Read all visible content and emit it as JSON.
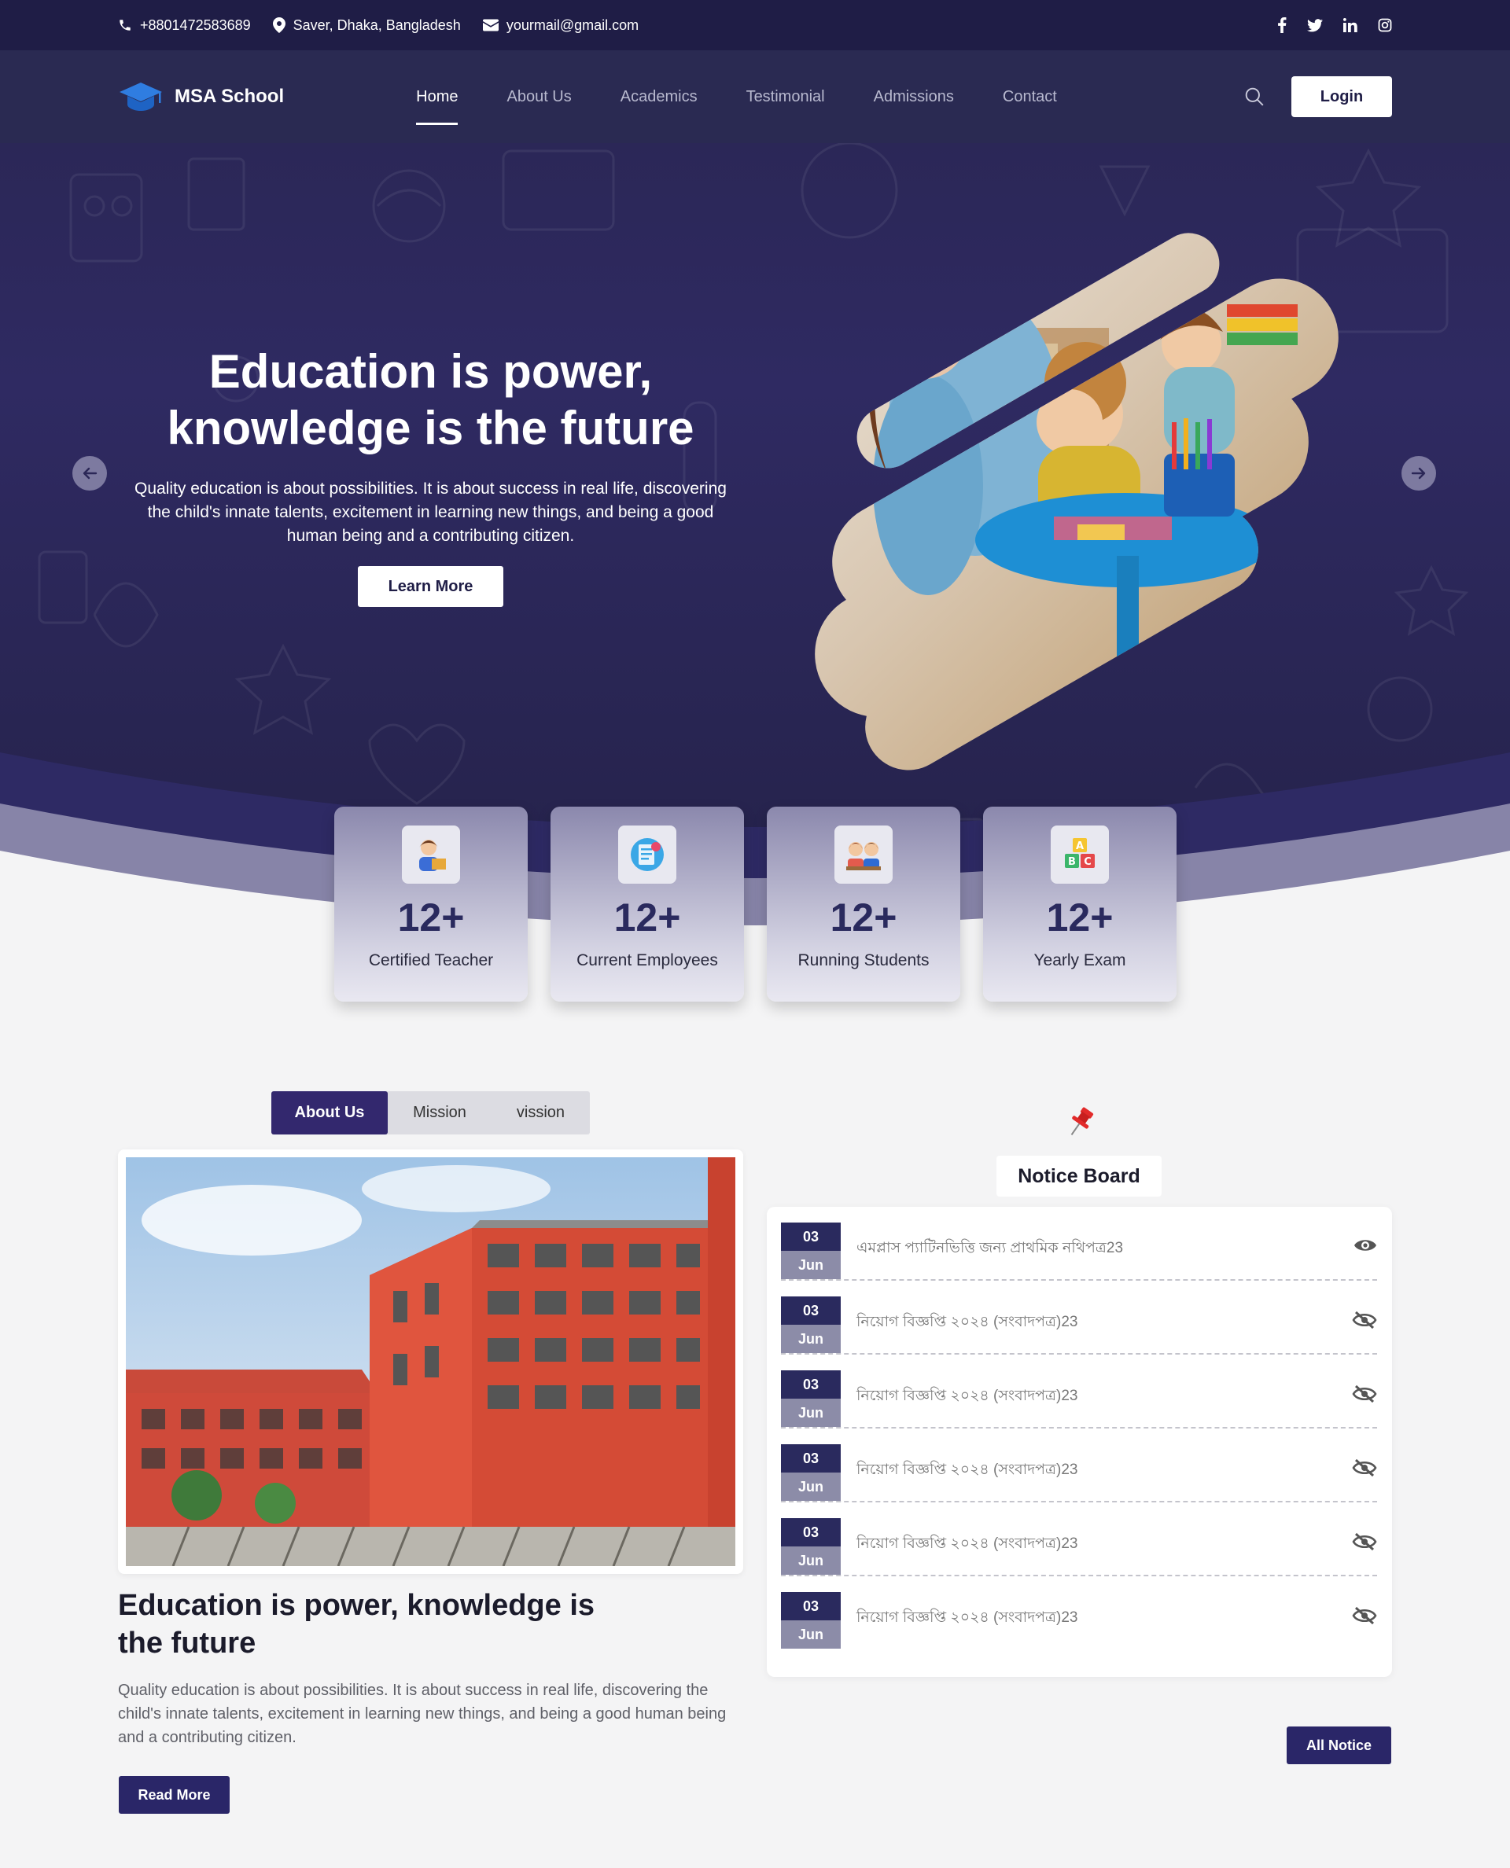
{
  "topbar": {
    "phone": "+8801472583689",
    "location": "Saver, Dhaka, Bangladesh",
    "email": "yourmail@gmail.com",
    "socials": [
      "facebook-icon",
      "twitter-icon",
      "linkedin-icon",
      "instagram-icon"
    ]
  },
  "nav": {
    "brand": "MSA School",
    "items": [
      "Home",
      "About Us",
      "Academics",
      "Testimonial",
      "Admissions",
      "Contact"
    ],
    "active": "Home",
    "login": "Login"
  },
  "hero": {
    "title_line1": "Education is power,",
    "title_line2": "knowledge is the future",
    "description": "Quality education is about possibilities. It is about success in real life, discovering the child's innate talents, excitement in learning new things, and being a good human being and a contributing citizen.",
    "cta": "Learn More"
  },
  "stats": [
    {
      "value": "12+",
      "label": "Certified Teacher",
      "icon": "teacher-icon"
    },
    {
      "value": "12+",
      "label": "Current Employees",
      "icon": "employee-icon"
    },
    {
      "value": "12+",
      "label": "Running Students",
      "icon": "students-icon"
    },
    {
      "value": "12+",
      "label": "Yearly Exam",
      "icon": "abc-blocks-icon"
    }
  ],
  "about": {
    "tabs": [
      "About Us",
      "Mission",
      "vission"
    ],
    "active_tab": "About Us",
    "title": "Education is power, knowledge is the future",
    "description": "Quality education is about possibilities. It is about success in real life, discovering the child's innate talents, excitement in learning new things, and being a good human being and a contributing citizen.",
    "cta": "Read More"
  },
  "notice_board": {
    "title": "Notice Board",
    "items": [
      {
        "day": "03",
        "month": "Jun",
        "text": "এমপ্লাস প্যাটিনভিত্তি জন্য প্রাথমিক নথিপত্র23",
        "viewed": true
      },
      {
        "day": "03",
        "month": "Jun",
        "text": "নিয়োগ বিজ্ঞপ্তি ২০২৪ (সংবাদপত্র)23",
        "viewed": false
      },
      {
        "day": "03",
        "month": "Jun",
        "text": "নিয়োগ বিজ্ঞপ্তি ২০২৪ (সংবাদপত্র)23",
        "viewed": false
      },
      {
        "day": "03",
        "month": "Jun",
        "text": "নিয়োগ বিজ্ঞপ্তি ২০২৪ (সংবাদপত্র)23",
        "viewed": false
      },
      {
        "day": "03",
        "month": "Jun",
        "text": "নিয়োগ বিজ্ঞপ্তি ২০২৪ (সংবাদপত্র)23",
        "viewed": false
      },
      {
        "day": "03",
        "month": "Jun",
        "text": "নিয়োগ বিজ্ঞপ্তি ২০২৪ (সংবাদপত্র)23",
        "viewed": false
      }
    ],
    "all_button": "All Notice"
  },
  "colors": {
    "topbar": "#1f1d46",
    "navbar": "#2a2a52",
    "hero": "#2f2a62",
    "accent": "#2a2668",
    "band": "#8784a8"
  }
}
